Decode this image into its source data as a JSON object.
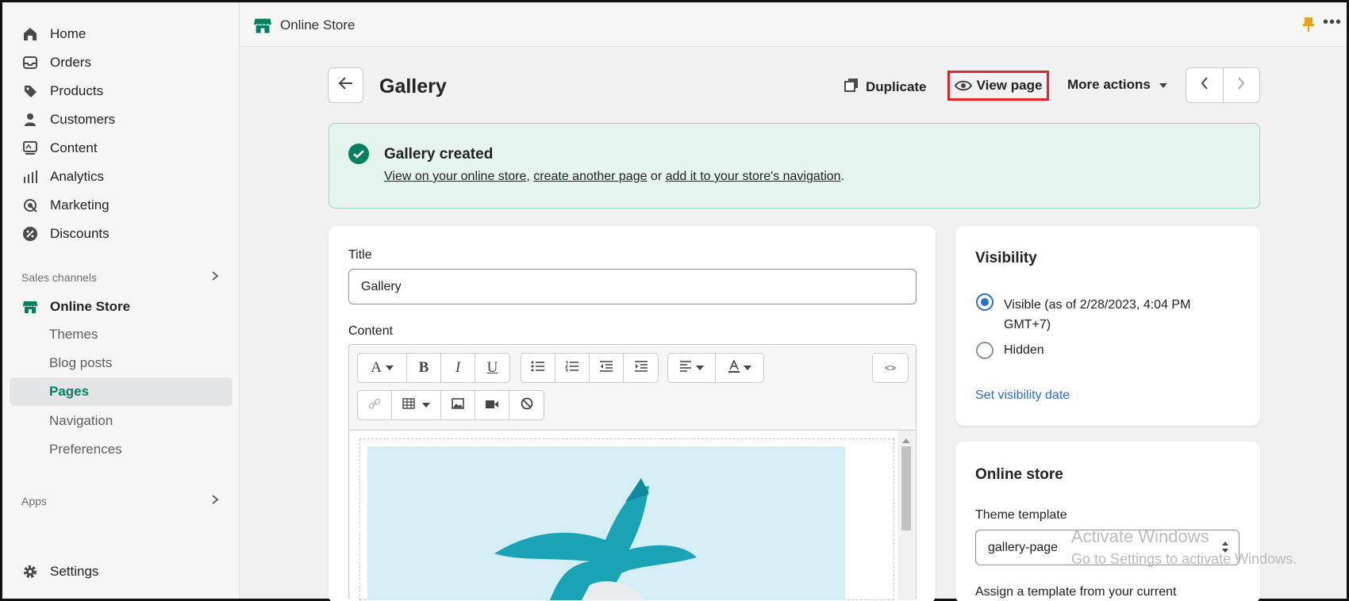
{
  "sidebar": {
    "items": [
      {
        "label": "Home",
        "icon": "home-icon"
      },
      {
        "label": "Orders",
        "icon": "orders-icon"
      },
      {
        "label": "Products",
        "icon": "tag-icon"
      },
      {
        "label": "Customers",
        "icon": "person-icon"
      },
      {
        "label": "Content",
        "icon": "content-icon"
      },
      {
        "label": "Analytics",
        "icon": "bar-chart-icon"
      },
      {
        "label": "Marketing",
        "icon": "target-icon"
      },
      {
        "label": "Discounts",
        "icon": "discount-icon"
      }
    ],
    "sales_channels": "Sales channels",
    "online_store": "Online Store",
    "subitems": [
      "Themes",
      "Blog posts",
      "Pages",
      "Navigation",
      "Preferences"
    ],
    "apps": "Apps",
    "settings": "Settings"
  },
  "topbar": {
    "title": "Online Store",
    "more": "•••"
  },
  "header": {
    "title": "Gallery",
    "duplicate": "Duplicate",
    "view_page": "View page",
    "more_actions": "More actions"
  },
  "banner": {
    "title": "Gallery created",
    "link1": "View on your online store",
    "sep1": ", ",
    "link2": "create another page",
    "sep2": " or ",
    "link3": "add it to your store's navigation",
    "end": "."
  },
  "form": {
    "title_label": "Title",
    "title_value": "Gallery",
    "content_label": "Content"
  },
  "visibility": {
    "heading": "Visibility",
    "visible_label": "Visible (as of 2/28/2023, 4:04 PM",
    "visible_label2": "GMT+7)",
    "hidden_label": "Hidden",
    "set_date": "Set visibility date"
  },
  "online_store_card": {
    "heading": "Online store",
    "theme_label": "Theme template",
    "theme_value": "gallery-page",
    "assign_text": "Assign a template from your current"
  },
  "watermark": {
    "line1": "Activate Windows",
    "line2": "Go to Settings to activate Windows."
  },
  "colors": {
    "accent": "#008060",
    "link": "#2c6ecb",
    "highlight": "#e0232b"
  }
}
